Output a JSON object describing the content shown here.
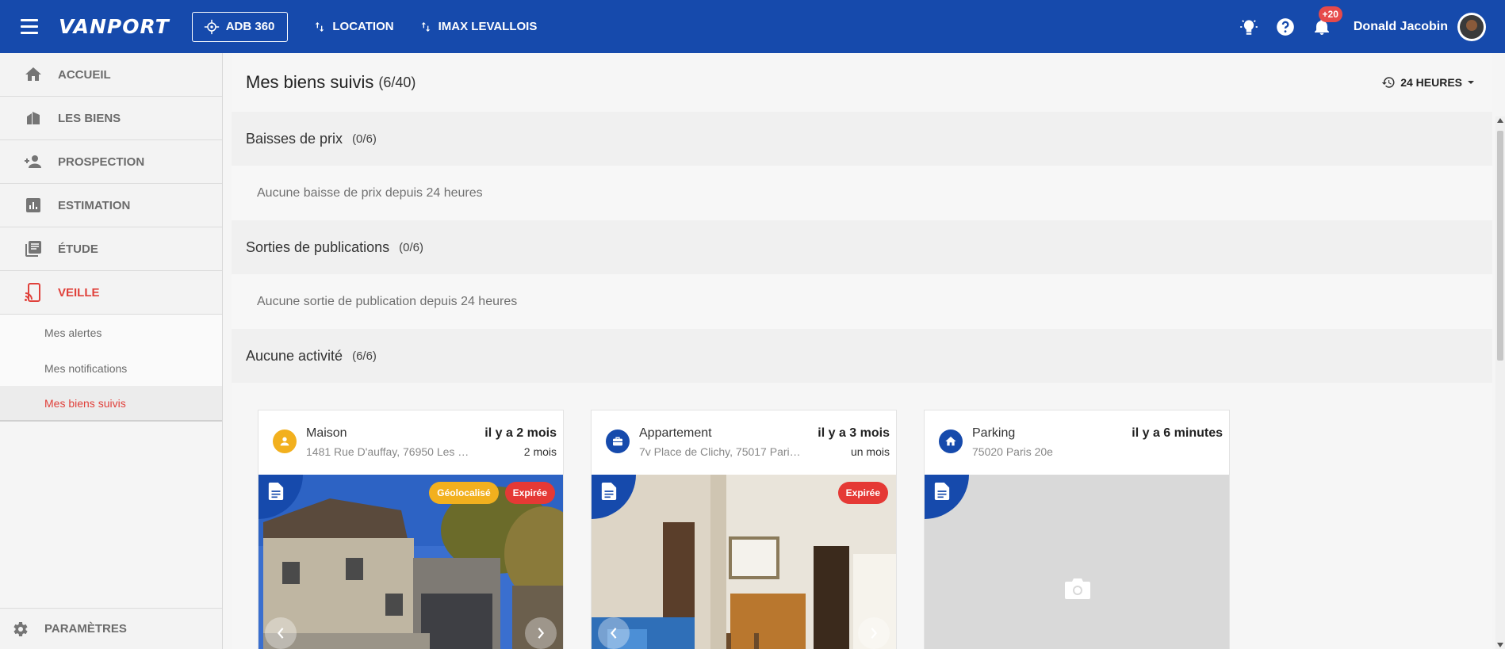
{
  "header": {
    "logo": "VANPORT",
    "adb_label": "ADB 360",
    "location_label": "LOCATION",
    "agency_label": "IMAX LEVALLOIS",
    "notif_badge": "+20",
    "user_name": "Donald Jacobin",
    "accent": "#164aac"
  },
  "sidebar": {
    "items": [
      {
        "label": "ACCUEIL",
        "icon": "home-icon"
      },
      {
        "label": "LES BIENS",
        "icon": "buildings-icon"
      },
      {
        "label": "PROSPECTION",
        "icon": "person-add-icon"
      },
      {
        "label": "ESTIMATION",
        "icon": "chart-icon"
      },
      {
        "label": "ÉTUDE",
        "icon": "library-icon"
      },
      {
        "label": "VEILLE",
        "icon": "cast-icon"
      }
    ],
    "sub_items": [
      "Mes alertes",
      "Mes notifications",
      "Mes biens suivis"
    ],
    "footer": "PARAMÈTRES"
  },
  "main": {
    "title": "Mes biens suivis",
    "count": "(6/40)",
    "period": "24 HEURES",
    "sections": [
      {
        "title": "Baisses de prix",
        "count": "(0/6)",
        "message": "Aucune baisse de prix depuis 24 heures"
      },
      {
        "title": "Sorties de publications",
        "count": "(0/6)",
        "message": "Aucune sortie de publication depuis 24 heures"
      },
      {
        "title": "Aucune activité",
        "count": "(6/6)"
      }
    ],
    "cards": [
      {
        "type": "Maison",
        "time": "il y a 2 mois",
        "address": "1481 Rue D'auffay, 76950 Les …",
        "sub": "2 mois",
        "tags": [
          "Géolocalisé",
          "Expirée"
        ]
      },
      {
        "type": "Appartement",
        "time": "il y a 3 mois",
        "address": "7v Place de Clichy, 75017 Pari…",
        "sub": "un mois",
        "tags": [
          "Expirée"
        ]
      },
      {
        "type": "Parking",
        "time": "il y a 6 minutes",
        "address": "75020 Paris 20e",
        "sub": "",
        "tags": []
      }
    ]
  },
  "colors": {
    "expired": "#e53935",
    "geoloc": "#f2b01e",
    "active_red": "#e0413b"
  }
}
